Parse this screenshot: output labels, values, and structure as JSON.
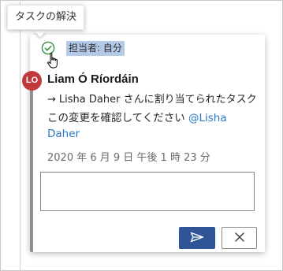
{
  "tooltip": {
    "text": "タスクの解決"
  },
  "task": {
    "assignee_badge": "担当者: 自分",
    "avatar_initials": "LO",
    "author": "Liam Ó Ríordáin",
    "assign_arrow": "→",
    "assign_text": "Lisha Daher さんに割り当てられたタスク",
    "comment_text": "この変更を確認してください ",
    "mention": "@Lisha Daher",
    "timestamp": "2020 年 6 月 9 日 午後 1 時 23 分"
  },
  "reply": {
    "value": "",
    "placeholder": ""
  },
  "icons": {
    "resolve": "check-circle-icon",
    "cursor": "hand-pointer-icon",
    "send": "send-icon",
    "cancel": "close-icon"
  },
  "colors": {
    "badge_background": "#b3c9e8",
    "avatar": "#c0393b",
    "mention": "#2b78c4",
    "send_button": "#2f5596",
    "check": "#3a8a3a",
    "accent_bar": "#8f8f8f"
  }
}
